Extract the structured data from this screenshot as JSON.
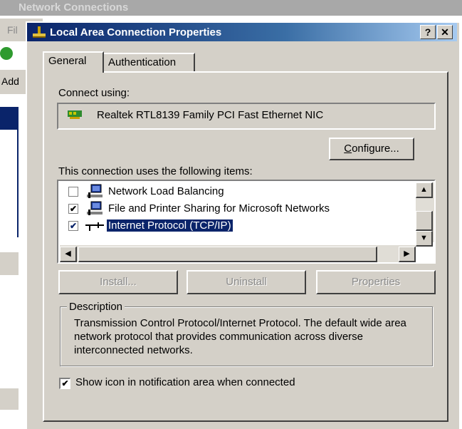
{
  "background_window": {
    "title": "Network Connections",
    "menu_first": "Fil",
    "address_label": "Add"
  },
  "dialog": {
    "title": "Local Area Connection Properties",
    "help_label": "?",
    "close_label": "✕",
    "tabs": [
      {
        "label": "General",
        "active": true
      },
      {
        "label": "Authentication",
        "active": false
      }
    ],
    "connect_using_label": "Connect using:",
    "adapter_name": "Realtek RTL8139 Family PCI Fast Ethernet NIC",
    "configure_label": "Configure...",
    "items_label": "This connection uses the following items:",
    "items": [
      {
        "label": "Network Load Balancing",
        "checked": false,
        "icon": "network-component-icon"
      },
      {
        "label": "File and Printer Sharing for Microsoft Networks",
        "checked": true,
        "icon": "network-component-icon"
      },
      {
        "label": "Internet Protocol (TCP/IP)",
        "checked": true,
        "selected": true,
        "icon": "protocol-icon"
      }
    ],
    "buttons": {
      "install": "Install...",
      "uninstall": "Uninstall",
      "properties": "Properties"
    },
    "description_legend": "Description",
    "description_text": "Transmission Control Protocol/Internet Protocol. The default wide area network protocol that provides communication across diverse interconnected networks.",
    "show_icon_checked": true,
    "show_icon_label": "Show icon in notification area when connected"
  },
  "colors": {
    "titlebar_start": "#0a246a",
    "titlebar_end": "#a6caf0",
    "face": "#d4d0c8",
    "selection": "#0a246a"
  }
}
